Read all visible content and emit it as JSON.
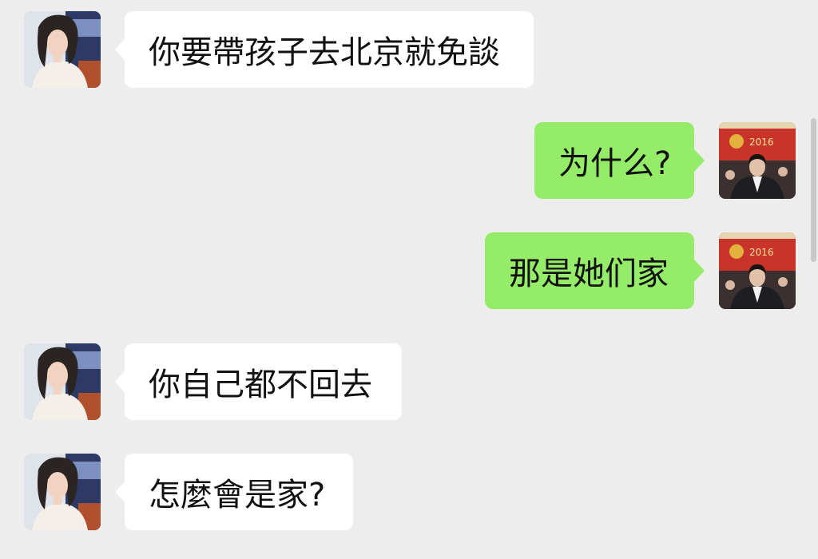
{
  "conversation": {
    "messages": [
      {
        "side": "left",
        "text": "你要帶孩子去北京就免談"
      },
      {
        "side": "right",
        "text": "为什么?"
      },
      {
        "side": "right",
        "text": "那是她们家"
      },
      {
        "side": "left",
        "text": "你自己都不回去"
      },
      {
        "side": "left",
        "text": "怎麼會是家?"
      }
    ],
    "contacts": {
      "left": {
        "avatar_icon": "woman-portrait-avatar"
      },
      "right": {
        "avatar_icon": "man-in-suit-at-event-avatar",
        "backdrop_text": "2016"
      }
    }
  },
  "colors": {
    "background": "#ededed",
    "incoming_bubble": "#ffffff",
    "outgoing_bubble": "#95ec69"
  }
}
